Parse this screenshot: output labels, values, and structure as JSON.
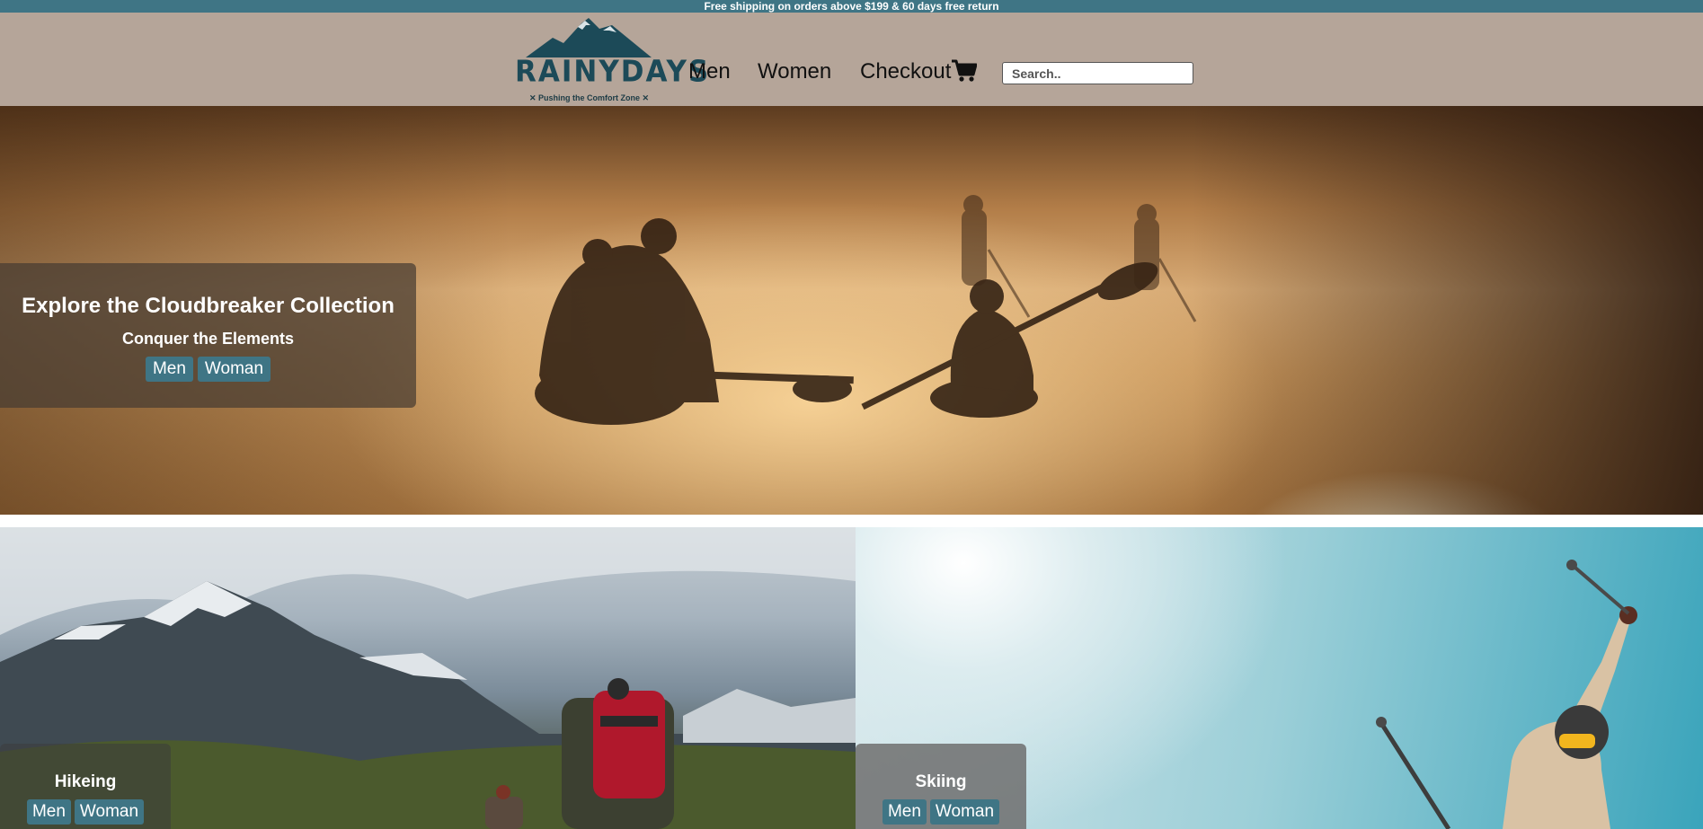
{
  "announcement": "Free shipping on orders above $199 & 60 days free return",
  "brand": {
    "name": "RAINYDAYS",
    "tagline": "✕ Pushing the Comfort Zone ✕"
  },
  "nav": {
    "men": "Men",
    "women": "Women",
    "checkout": "Checkout"
  },
  "search": {
    "placeholder": "Search.."
  },
  "hero": {
    "title": "Explore the Cloudbreaker Collection",
    "subtitle": "Conquer the Elements",
    "men_button": "Men",
    "woman_button": "Woman"
  },
  "categories": [
    {
      "title": "Hikeing",
      "men_button": "Men",
      "woman_button": "Woman"
    },
    {
      "title": "Skiing",
      "men_button": "Men",
      "woman_button": "Woman"
    }
  ],
  "colors": {
    "accent": "#3f7585",
    "header_bg": "#b5a599",
    "brand_text": "#1c4a58"
  }
}
